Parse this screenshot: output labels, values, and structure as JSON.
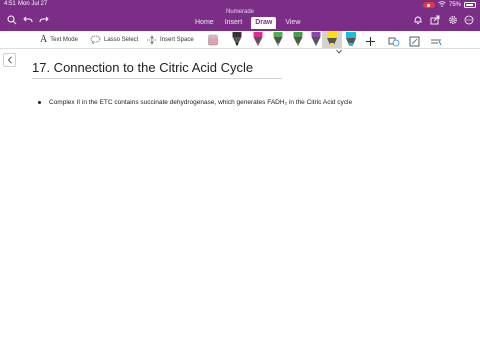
{
  "status_bar": {
    "time": "4:51",
    "date": "Mon Jul 27",
    "battery": "75%"
  },
  "app": {
    "title": "Numerade"
  },
  "tabs": [
    {
      "label": "Home"
    },
    {
      "label": "Insert"
    },
    {
      "label": "Draw"
    },
    {
      "label": "View"
    }
  ],
  "toolbar": {
    "text_mode": "Text Mode",
    "lasso_select": "Lasso Select",
    "insert_space": "Insert Space"
  },
  "page": {
    "title": "17. Connection to the Citric Acid Cycle",
    "bullets": [
      "Complex II in the ETC contains succinate dehydrogenase, which generates FADH₂ in the Citric Acid cycle"
    ]
  },
  "colors": {
    "header": "#7a2e86",
    "pen_black": "#111111",
    "pen_magenta": "#e0289b",
    "pen_green": "#4caf50",
    "pen_purple": "#8e44ad",
    "pen_yellow": "#ffe000",
    "pen_cyan": "#15c3d6"
  }
}
